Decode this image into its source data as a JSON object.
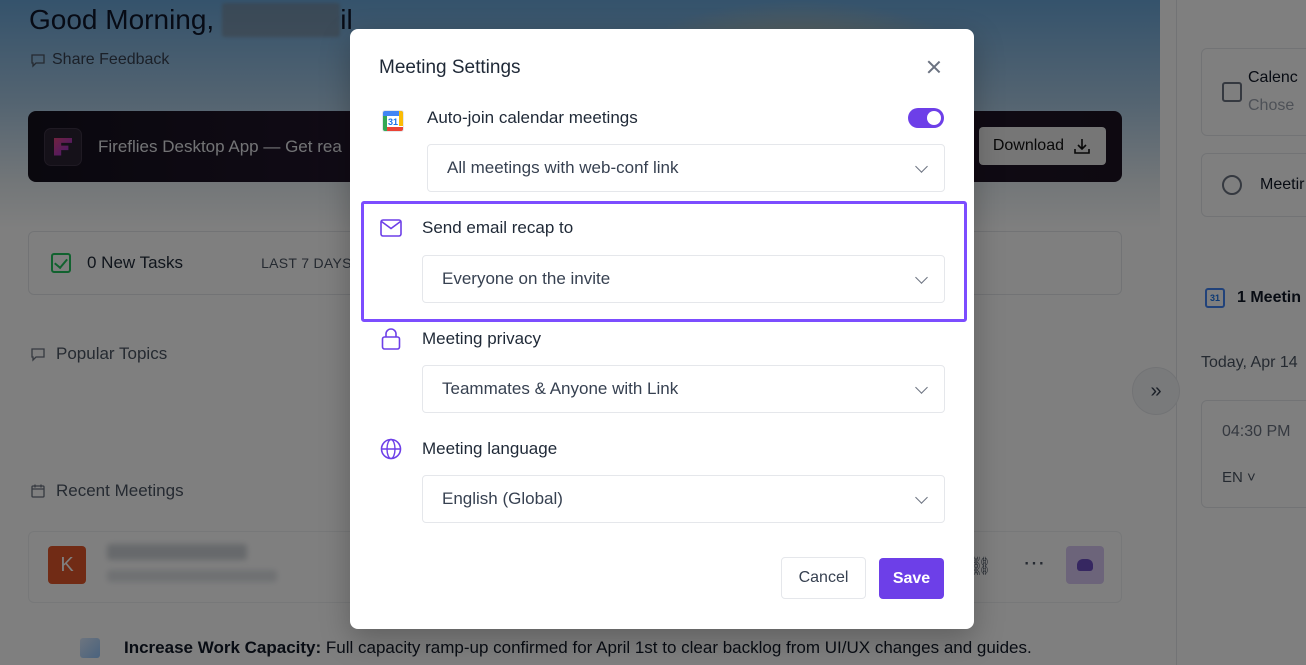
{
  "background": {
    "greeting": "Good Morning,",
    "greeting_tail": "il",
    "share_feedback": "Share Feedback",
    "banner": {
      "text": "Fireflies Desktop App — Get rea",
      "download_label": "Download"
    },
    "tasks": {
      "label": "0 New Tasks",
      "range": "LAST 7 DAYS"
    },
    "popular_topics": "Popular Topics",
    "recent_meetings": "Recent Meetings",
    "meeting_avatar_letter": "K",
    "summary": {
      "bold": "Increase Work Capacity:",
      "text": " Full capacity ramp-up confirmed for April 1st to clear backlog from UI/UX changes and guides."
    },
    "collapse_glyph": "»",
    "right_panel": {
      "calendar_title": "Calenc",
      "calendar_sub": "Chose",
      "meeting_label": "Meetir",
      "meetings_count": "1 Meetin",
      "date": "Today, Apr 14",
      "slot_time": "04:30 PM",
      "slot_lang": "EN ˅"
    }
  },
  "modal": {
    "title": "Meeting Settings",
    "settings": [
      {
        "label": "Auto-join calendar meetings",
        "icon": "google-calendar-icon",
        "value": "All meetings with web-conf link",
        "toggle_on": true
      },
      {
        "label": "Send email recap to",
        "icon": "mail-icon",
        "value": "Everyone on the invite"
      },
      {
        "label": "Meeting privacy",
        "icon": "lock-icon",
        "value": "Teammates & Anyone with Link"
      },
      {
        "label": "Meeting language",
        "icon": "globe-icon",
        "value": "English (Global)"
      }
    ],
    "calendar_icon_day": "31",
    "cancel_label": "Cancel",
    "save_label": "Save"
  },
  "colors": {
    "accent": "#6d3fe8",
    "highlight": "#7c4dff",
    "icon_purple": "#6d3fe8"
  }
}
